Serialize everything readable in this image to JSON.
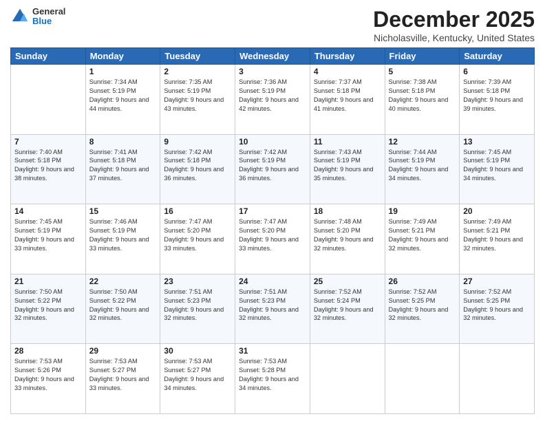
{
  "header": {
    "logo_general": "General",
    "logo_blue": "Blue",
    "month": "December 2025",
    "location": "Nicholasville, Kentucky, United States"
  },
  "days_of_week": [
    "Sunday",
    "Monday",
    "Tuesday",
    "Wednesday",
    "Thursday",
    "Friday",
    "Saturday"
  ],
  "weeks": [
    [
      {
        "day": "",
        "sunrise": "",
        "sunset": "",
        "daylight": ""
      },
      {
        "day": "1",
        "sunrise": "Sunrise: 7:34 AM",
        "sunset": "Sunset: 5:19 PM",
        "daylight": "Daylight: 9 hours and 44 minutes."
      },
      {
        "day": "2",
        "sunrise": "Sunrise: 7:35 AM",
        "sunset": "Sunset: 5:19 PM",
        "daylight": "Daylight: 9 hours and 43 minutes."
      },
      {
        "day": "3",
        "sunrise": "Sunrise: 7:36 AM",
        "sunset": "Sunset: 5:19 PM",
        "daylight": "Daylight: 9 hours and 42 minutes."
      },
      {
        "day": "4",
        "sunrise": "Sunrise: 7:37 AM",
        "sunset": "Sunset: 5:18 PM",
        "daylight": "Daylight: 9 hours and 41 minutes."
      },
      {
        "day": "5",
        "sunrise": "Sunrise: 7:38 AM",
        "sunset": "Sunset: 5:18 PM",
        "daylight": "Daylight: 9 hours and 40 minutes."
      },
      {
        "day": "6",
        "sunrise": "Sunrise: 7:39 AM",
        "sunset": "Sunset: 5:18 PM",
        "daylight": "Daylight: 9 hours and 39 minutes."
      }
    ],
    [
      {
        "day": "7",
        "sunrise": "Sunrise: 7:40 AM",
        "sunset": "Sunset: 5:18 PM",
        "daylight": "Daylight: 9 hours and 38 minutes."
      },
      {
        "day": "8",
        "sunrise": "Sunrise: 7:41 AM",
        "sunset": "Sunset: 5:18 PM",
        "daylight": "Daylight: 9 hours and 37 minutes."
      },
      {
        "day": "9",
        "sunrise": "Sunrise: 7:42 AM",
        "sunset": "Sunset: 5:18 PM",
        "daylight": "Daylight: 9 hours and 36 minutes."
      },
      {
        "day": "10",
        "sunrise": "Sunrise: 7:42 AM",
        "sunset": "Sunset: 5:19 PM",
        "daylight": "Daylight: 9 hours and 36 minutes."
      },
      {
        "day": "11",
        "sunrise": "Sunrise: 7:43 AM",
        "sunset": "Sunset: 5:19 PM",
        "daylight": "Daylight: 9 hours and 35 minutes."
      },
      {
        "day": "12",
        "sunrise": "Sunrise: 7:44 AM",
        "sunset": "Sunset: 5:19 PM",
        "daylight": "Daylight: 9 hours and 34 minutes."
      },
      {
        "day": "13",
        "sunrise": "Sunrise: 7:45 AM",
        "sunset": "Sunset: 5:19 PM",
        "daylight": "Daylight: 9 hours and 34 minutes."
      }
    ],
    [
      {
        "day": "14",
        "sunrise": "Sunrise: 7:45 AM",
        "sunset": "Sunset: 5:19 PM",
        "daylight": "Daylight: 9 hours and 33 minutes."
      },
      {
        "day": "15",
        "sunrise": "Sunrise: 7:46 AM",
        "sunset": "Sunset: 5:19 PM",
        "daylight": "Daylight: 9 hours and 33 minutes."
      },
      {
        "day": "16",
        "sunrise": "Sunrise: 7:47 AM",
        "sunset": "Sunset: 5:20 PM",
        "daylight": "Daylight: 9 hours and 33 minutes."
      },
      {
        "day": "17",
        "sunrise": "Sunrise: 7:47 AM",
        "sunset": "Sunset: 5:20 PM",
        "daylight": "Daylight: 9 hours and 33 minutes."
      },
      {
        "day": "18",
        "sunrise": "Sunrise: 7:48 AM",
        "sunset": "Sunset: 5:20 PM",
        "daylight": "Daylight: 9 hours and 32 minutes."
      },
      {
        "day": "19",
        "sunrise": "Sunrise: 7:49 AM",
        "sunset": "Sunset: 5:21 PM",
        "daylight": "Daylight: 9 hours and 32 minutes."
      },
      {
        "day": "20",
        "sunrise": "Sunrise: 7:49 AM",
        "sunset": "Sunset: 5:21 PM",
        "daylight": "Daylight: 9 hours and 32 minutes."
      }
    ],
    [
      {
        "day": "21",
        "sunrise": "Sunrise: 7:50 AM",
        "sunset": "Sunset: 5:22 PM",
        "daylight": "Daylight: 9 hours and 32 minutes."
      },
      {
        "day": "22",
        "sunrise": "Sunrise: 7:50 AM",
        "sunset": "Sunset: 5:22 PM",
        "daylight": "Daylight: 9 hours and 32 minutes."
      },
      {
        "day": "23",
        "sunrise": "Sunrise: 7:51 AM",
        "sunset": "Sunset: 5:23 PM",
        "daylight": "Daylight: 9 hours and 32 minutes."
      },
      {
        "day": "24",
        "sunrise": "Sunrise: 7:51 AM",
        "sunset": "Sunset: 5:23 PM",
        "daylight": "Daylight: 9 hours and 32 minutes."
      },
      {
        "day": "25",
        "sunrise": "Sunrise: 7:52 AM",
        "sunset": "Sunset: 5:24 PM",
        "daylight": "Daylight: 9 hours and 32 minutes."
      },
      {
        "day": "26",
        "sunrise": "Sunrise: 7:52 AM",
        "sunset": "Sunset: 5:25 PM",
        "daylight": "Daylight: 9 hours and 32 minutes."
      },
      {
        "day": "27",
        "sunrise": "Sunrise: 7:52 AM",
        "sunset": "Sunset: 5:25 PM",
        "daylight": "Daylight: 9 hours and 32 minutes."
      }
    ],
    [
      {
        "day": "28",
        "sunrise": "Sunrise: 7:53 AM",
        "sunset": "Sunset: 5:26 PM",
        "daylight": "Daylight: 9 hours and 33 minutes."
      },
      {
        "day": "29",
        "sunrise": "Sunrise: 7:53 AM",
        "sunset": "Sunset: 5:27 PM",
        "daylight": "Daylight: 9 hours and 33 minutes."
      },
      {
        "day": "30",
        "sunrise": "Sunrise: 7:53 AM",
        "sunset": "Sunset: 5:27 PM",
        "daylight": "Daylight: 9 hours and 34 minutes."
      },
      {
        "day": "31",
        "sunrise": "Sunrise: 7:53 AM",
        "sunset": "Sunset: 5:28 PM",
        "daylight": "Daylight: 9 hours and 34 minutes."
      },
      {
        "day": "",
        "sunrise": "",
        "sunset": "",
        "daylight": ""
      },
      {
        "day": "",
        "sunrise": "",
        "sunset": "",
        "daylight": ""
      },
      {
        "day": "",
        "sunrise": "",
        "sunset": "",
        "daylight": ""
      }
    ]
  ]
}
